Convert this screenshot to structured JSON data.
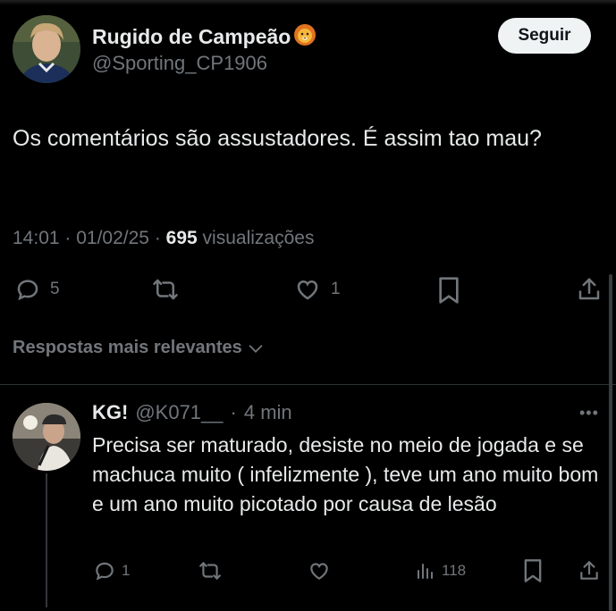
{
  "post": {
    "author_name": "Rugido de Campeão",
    "author_emoji": "🦁",
    "handle": "@Sporting_CP1906",
    "follow_label": "Seguir",
    "text": "Os comentários são assustadores. É assim tao mau?",
    "time": "14:01",
    "date": "01/02/25",
    "views_count": "695",
    "views_label": "visualizações",
    "replies_count": "5",
    "likes_count": "1",
    "icons": [
      "reply-icon",
      "retweet-icon",
      "like-icon",
      "bookmark-icon",
      "share-icon"
    ]
  },
  "sort": {
    "label": "Respostas mais relevantes"
  },
  "reply": {
    "name": "KG!",
    "handle": "@K071__",
    "separator": "·",
    "time": "4 min",
    "text": "Precisa ser maturado, desiste no meio de jogada e se machuca muito ( infelizmente ), teve um ano muito bom e um ano muito picotado por causa de lesão",
    "replies_count": "1",
    "views_count": "118",
    "icons": [
      "reply-icon",
      "retweet-icon",
      "like-icon",
      "analytics-icon",
      "bookmark-icon",
      "share-icon"
    ]
  },
  "colors": {
    "background": "#000000",
    "text": "#e7e9ea",
    "muted": "#71767b",
    "divider": "#2f3336",
    "follow_bg": "#eff3f4"
  }
}
